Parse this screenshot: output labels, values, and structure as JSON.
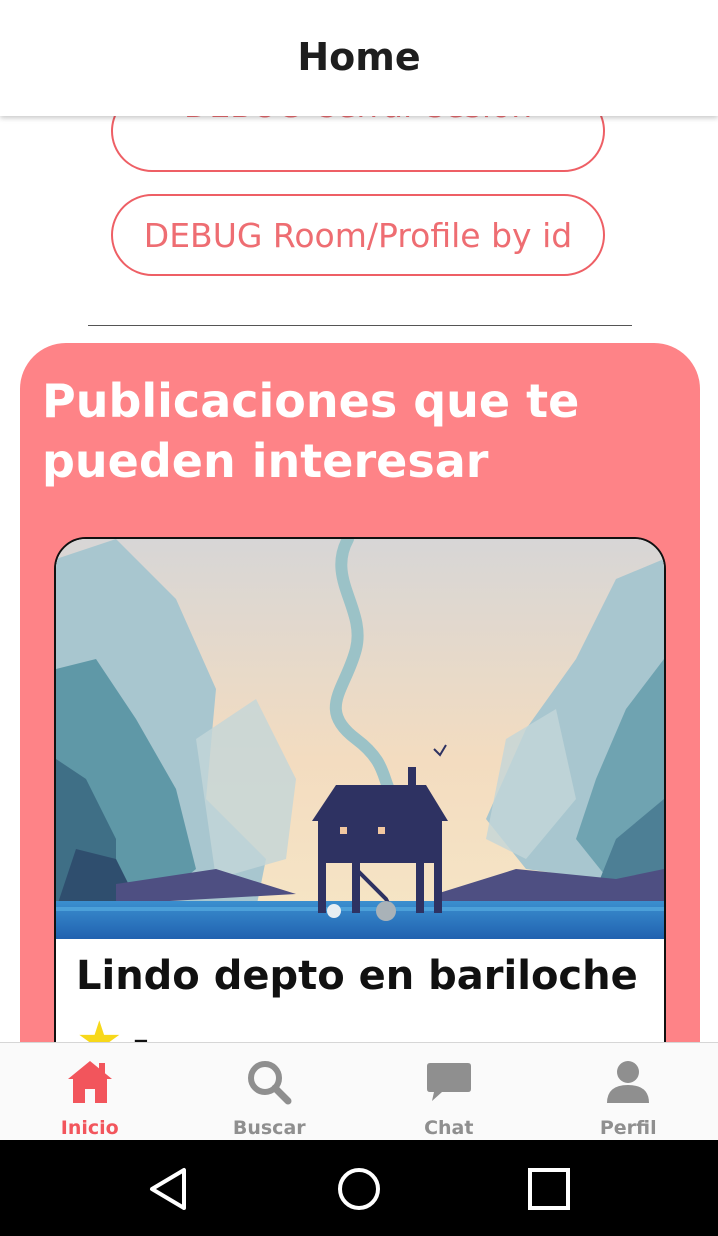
{
  "appbar": {
    "title": "Home"
  },
  "debug": {
    "logout_label": "DEBUG Cerrar sesión",
    "room_profile_label": "DEBUG Room/Profile by id"
  },
  "recommendations": {
    "title": "Publicaciones que te pueden interesar",
    "card": {
      "title": "Lindo depto en bariloche",
      "rating_text": "-",
      "image_icon": "cabin-landscape-illustration",
      "carousel_pages": 2,
      "carousel_current": 2
    }
  },
  "bottom_nav": {
    "items": [
      {
        "label": "Inicio",
        "icon": "home-icon",
        "active": true
      },
      {
        "label": "Buscar",
        "icon": "search-icon",
        "active": false
      },
      {
        "label": "Chat",
        "icon": "chat-icon",
        "active": false
      },
      {
        "label": "Perfil",
        "icon": "person-icon",
        "active": false
      }
    ]
  },
  "colors": {
    "accent": "#fe8387",
    "active_tab": "#f2555c",
    "inactive_tab": "#8f8f8f",
    "star": "#f7d81a"
  }
}
